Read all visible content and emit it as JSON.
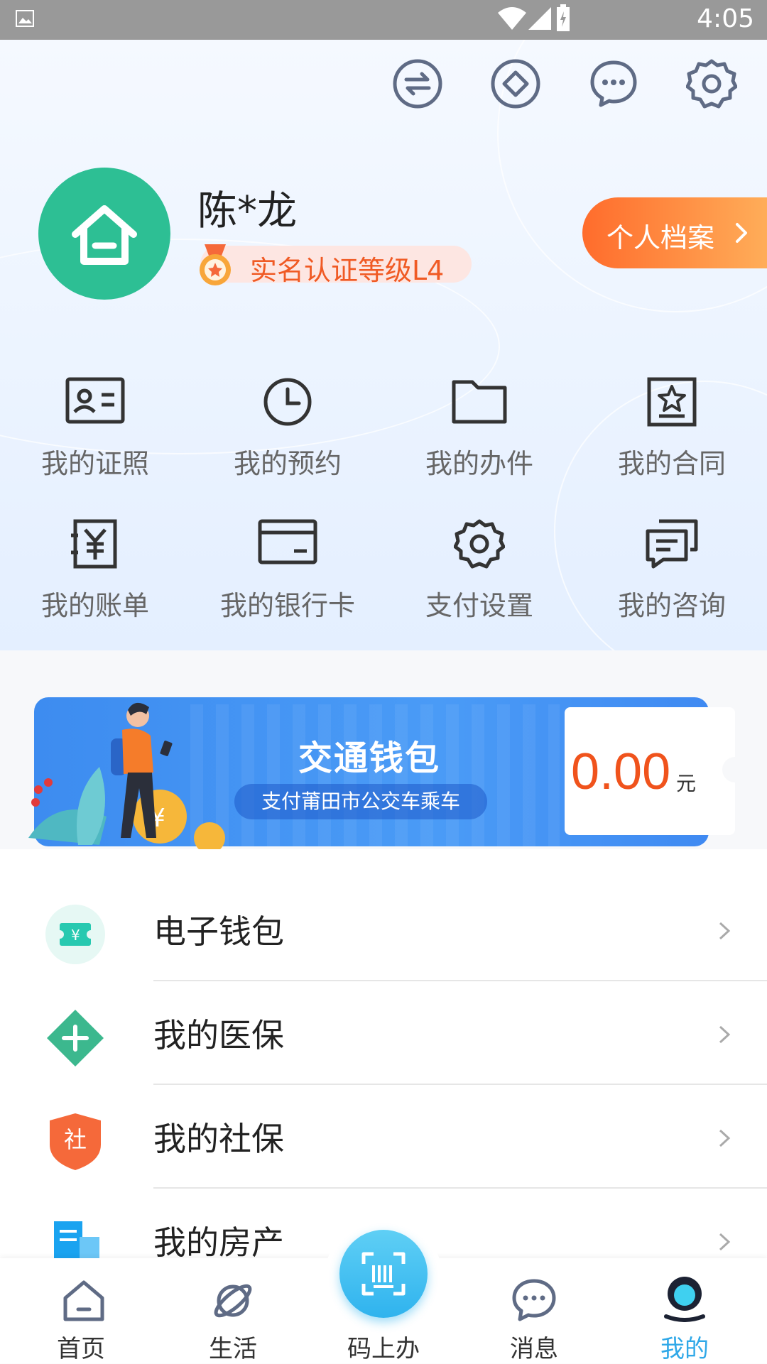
{
  "status_bar": {
    "time": "4:05"
  },
  "profile": {
    "name": "陈*龙",
    "cert_level": "实名认证等级L4",
    "archive_button": "个人档案"
  },
  "top_icons": [
    "transfer-icon",
    "diamond-icon",
    "chat-icon",
    "settings-icon"
  ],
  "grid": [
    {
      "label": "我的证照",
      "icon": "id-card-icon"
    },
    {
      "label": "我的预约",
      "icon": "clock-icon"
    },
    {
      "label": "我的办件",
      "icon": "folder-icon"
    },
    {
      "label": "我的合同",
      "icon": "contract-icon"
    },
    {
      "label": "我的账单",
      "icon": "bill-icon"
    },
    {
      "label": "我的银行卡",
      "icon": "bank-card-icon"
    },
    {
      "label": "支付设置",
      "icon": "gear-icon"
    },
    {
      "label": "我的咨询",
      "icon": "consult-icon"
    }
  ],
  "wallet": {
    "title": "交通钱包",
    "subtitle": "支付莆田市公交车乘车",
    "balance": "0.00",
    "unit": "元"
  },
  "list": [
    {
      "label": "电子钱包",
      "icon": "e-wallet-icon",
      "color": "#27c9b0"
    },
    {
      "label": "我的医保",
      "icon": "medical-insurance-icon",
      "color": "#3cb88e"
    },
    {
      "label": "我的社保",
      "icon": "social-security-icon",
      "color": "#f5693a",
      "glyph": "社"
    },
    {
      "label": "我的房产",
      "icon": "property-icon",
      "color": "#1aa3f0"
    }
  ],
  "nav": [
    {
      "label": "首页",
      "icon": "home-icon"
    },
    {
      "label": "生活",
      "icon": "planet-icon"
    },
    {
      "label": "码上办",
      "icon": "scan-code-icon"
    },
    {
      "label": "消息",
      "icon": "message-icon"
    },
    {
      "label": "我的",
      "icon": "profile-icon",
      "active": true
    }
  ],
  "colors": {
    "accent": "#2fa8e8",
    "orange": "#f05a24",
    "avatar": "#2dbf94"
  }
}
